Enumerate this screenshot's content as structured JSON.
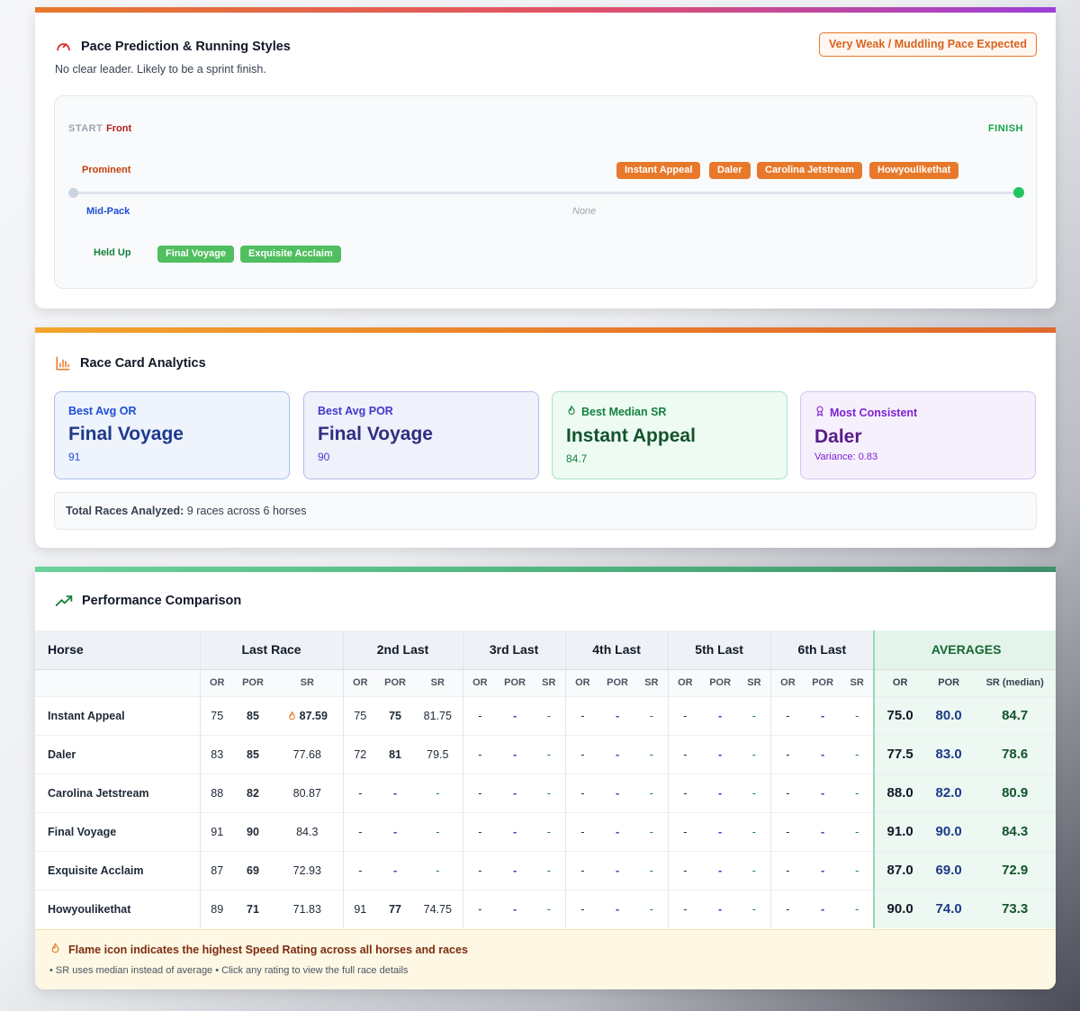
{
  "pace": {
    "title": "Pace Prediction & Running Styles",
    "subtitle": "No clear leader. Likely to be a sprint finish.",
    "badge": "Very Weak / Muddling Pace Expected",
    "start_label": "START",
    "front_label": "Front",
    "finish_label": "FINISH",
    "rows": {
      "prominent": "Prominent",
      "midpack": "Mid-Pack",
      "heldup": "Held Up"
    },
    "midpack_empty": "None",
    "prominent_horses": [
      "Instant Appeal",
      "Daler",
      "Carolina Jetstream",
      "Howyoulikethat"
    ],
    "heldup_horses": [
      "Final Voyage",
      "Exquisite Acclaim"
    ]
  },
  "analytics": {
    "title": "Race Card Analytics",
    "cards": [
      {
        "title": "Best Avg OR",
        "value": "Final Voyage",
        "sub": "91"
      },
      {
        "title": "Best Avg POR",
        "value": "Final Voyage",
        "sub": "90"
      },
      {
        "title": "Best Median SR",
        "value": "Instant Appeal",
        "sub": "84.7"
      },
      {
        "title": "Most Consistent",
        "value": "Daler",
        "sub": "Variance: 0.83"
      }
    ],
    "total_label": "Total Races Analyzed:",
    "total_value": "9 races across 6 horses"
  },
  "performance": {
    "title": "Performance Comparison",
    "headers": {
      "horse": "Horse",
      "groups": [
        "Last Race",
        "2nd Last",
        "3rd Last",
        "4th Last",
        "5th Last",
        "6th Last"
      ],
      "averages": "AVERAGES",
      "sub": [
        "OR",
        "POR",
        "SR"
      ],
      "avg_sub": [
        "OR",
        "POR",
        "SR (median)"
      ]
    },
    "rows": [
      {
        "horse": "Instant Appeal",
        "races": [
          [
            "75",
            "85",
            "87.59"
          ],
          [
            "75",
            "75",
            "81.75"
          ],
          [
            "-",
            "-",
            "-"
          ],
          [
            "-",
            "-",
            "-"
          ],
          [
            "-",
            "-",
            "-"
          ],
          [
            "-",
            "-",
            "-"
          ]
        ],
        "avg": [
          "75.0",
          "80.0",
          "84.7"
        ]
      },
      {
        "horse": "Daler",
        "races": [
          [
            "83",
            "85",
            "77.68"
          ],
          [
            "72",
            "81",
            "79.5"
          ],
          [
            "-",
            "-",
            "-"
          ],
          [
            "-",
            "-",
            "-"
          ],
          [
            "-",
            "-",
            "-"
          ],
          [
            "-",
            "-",
            "-"
          ]
        ],
        "avg": [
          "77.5",
          "83.0",
          "78.6"
        ]
      },
      {
        "horse": "Carolina Jetstream",
        "races": [
          [
            "88",
            "82",
            "80.87"
          ],
          [
            "-",
            "-",
            "-"
          ],
          [
            "-",
            "-",
            "-"
          ],
          [
            "-",
            "-",
            "-"
          ],
          [
            "-",
            "-",
            "-"
          ],
          [
            "-",
            "-",
            "-"
          ]
        ],
        "avg": [
          "88.0",
          "82.0",
          "80.9"
        ]
      },
      {
        "horse": "Final Voyage",
        "races": [
          [
            "91",
            "90",
            "84.3"
          ],
          [
            "-",
            "-",
            "-"
          ],
          [
            "-",
            "-",
            "-"
          ],
          [
            "-",
            "-",
            "-"
          ],
          [
            "-",
            "-",
            "-"
          ],
          [
            "-",
            "-",
            "-"
          ]
        ],
        "avg": [
          "91.0",
          "90.0",
          "84.3"
        ]
      },
      {
        "horse": "Exquisite Acclaim",
        "races": [
          [
            "87",
            "69",
            "72.93"
          ],
          [
            "-",
            "-",
            "-"
          ],
          [
            "-",
            "-",
            "-"
          ],
          [
            "-",
            "-",
            "-"
          ],
          [
            "-",
            "-",
            "-"
          ],
          [
            "-",
            "-",
            "-"
          ]
        ],
        "avg": [
          "87.0",
          "69.0",
          "72.9"
        ]
      },
      {
        "horse": "Howyoulikethat",
        "races": [
          [
            "89",
            "71",
            "71.83"
          ],
          [
            "91",
            "77",
            "74.75"
          ],
          [
            "-",
            "-",
            "-"
          ],
          [
            "-",
            "-",
            "-"
          ],
          [
            "-",
            "-",
            "-"
          ],
          [
            "-",
            "-",
            "-"
          ]
        ],
        "avg": [
          "90.0",
          "74.0",
          "73.3"
        ]
      }
    ],
    "note_title": "Flame icon indicates the highest Speed Rating across all horses and races",
    "note_text": "• SR uses median instead of average • Click any rating to view the full race details"
  },
  "colors": {
    "accent_orange": "#e8792b",
    "held_up_green": "#4fbf5f",
    "por_indigo": "#4338ca",
    "sr_green": "#15803d"
  }
}
